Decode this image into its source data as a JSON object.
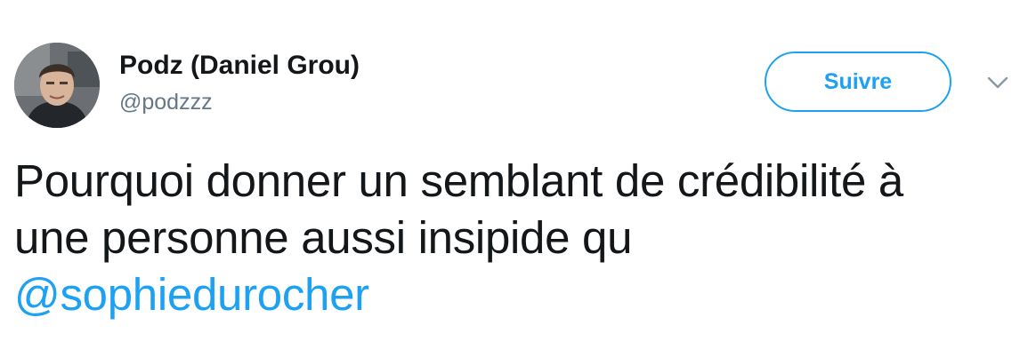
{
  "tweet": {
    "author": {
      "display_name": "Podz (Daniel Grou)",
      "handle": "@podzzz",
      "avatar_icon": "user-photo-avatar"
    },
    "follow_label": "Suivre",
    "menu_icon": "chevron-down-icon",
    "text_line_1": "Pourquoi donner un semblant de crédibilité à",
    "text_line_2": "une personne aussi insipide qu",
    "mention": "@sophiedurocher"
  },
  "colors": {
    "accent": "#1da1f2",
    "text": "#14171a",
    "secondary": "#657786"
  }
}
